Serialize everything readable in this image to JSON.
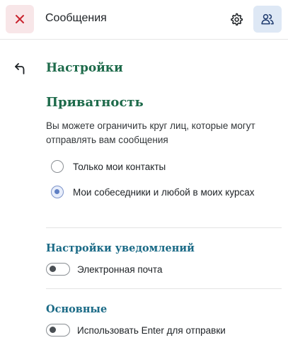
{
  "header": {
    "title": "Сообщения",
    "close_icon": "close-icon",
    "settings_icon": "gear-icon",
    "contacts_icon": "contacts-icon"
  },
  "settings": {
    "title": "Настройки",
    "back_icon": "back-arrow-icon"
  },
  "privacy": {
    "title": "Приватность",
    "description": "Вы можете ограничить круг лиц, которые могут отправлять вам сообщения",
    "options": [
      {
        "label": "Только мои контакты",
        "checked": false
      },
      {
        "label": "Мои собеседники и любой в моих курсах",
        "checked": true
      }
    ]
  },
  "notifications": {
    "title": "Настройки уведомлений",
    "email_label": "Электронная почта",
    "email_enabled": false
  },
  "general": {
    "title": "Основные",
    "enter_label": "Использовать Enter для отправки",
    "enter_enabled": false
  },
  "colors": {
    "accent_green": "#1d6a4a",
    "section_blue": "#1a6a86",
    "close_red": "#c9252f",
    "close_bg": "#f8e6e8",
    "contacts_bg": "#dee8f5"
  }
}
